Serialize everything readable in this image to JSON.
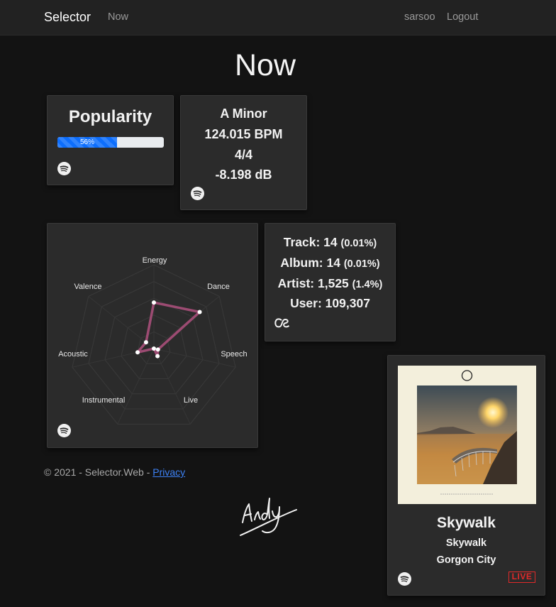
{
  "navbar": {
    "brand": "Selector",
    "links": {
      "now": "Now",
      "user": "sarsoo",
      "logout": "Logout"
    }
  },
  "page": {
    "title": "Now"
  },
  "popularity": {
    "title": "Popularity",
    "value": 56,
    "label": "56%",
    "icon": "spotify-icon",
    "bar_color": "#0d6efd"
  },
  "audio_features": {
    "key": "A Minor",
    "tempo": "124.015 BPM",
    "time_signature": "4/4",
    "loudness": "-8.198 dB",
    "icon": "spotify-icon"
  },
  "radar": {
    "labels": {
      "energy": "Energy",
      "dance": "Dance",
      "speech": "Speech",
      "live": "Live",
      "instrumental": "Instrumental",
      "acoustic": "Acoustic",
      "valence": "Valence"
    },
    "icon": "spotify-icon",
    "line_color": "#9c4b72"
  },
  "chart_data": {
    "type": "radar",
    "categories": [
      "Energy",
      "Dance",
      "Speech",
      "Live",
      "Instrumental",
      "Acoustic",
      "Valence"
    ],
    "values": [
      0.55,
      0.7,
      0.05,
      0.1,
      0.0,
      0.2,
      0.12
    ],
    "ylim": [
      0,
      1
    ],
    "grid": true
  },
  "scrobbles": {
    "track": {
      "label": "Track: 14",
      "pct": "(0.01%)"
    },
    "album": {
      "label": "Album: 14",
      "pct": "(0.01%)"
    },
    "artist": {
      "label": "Artist: 1,525",
      "pct": "(1.4%)"
    },
    "user": {
      "label": "User: 109,307"
    },
    "icon": "lastfm-icon"
  },
  "now_playing": {
    "track": "Skywalk",
    "album": "Skywalk",
    "artist": "Gorgon City",
    "live_badge": "LIVE",
    "icon": "spotify-icon",
    "live_color": "#e02a2a"
  },
  "footer": {
    "copyright": "© 2021 - Selector.Web - ",
    "privacy_link": "Privacy"
  },
  "signature": {
    "icon": "signature-logo"
  }
}
